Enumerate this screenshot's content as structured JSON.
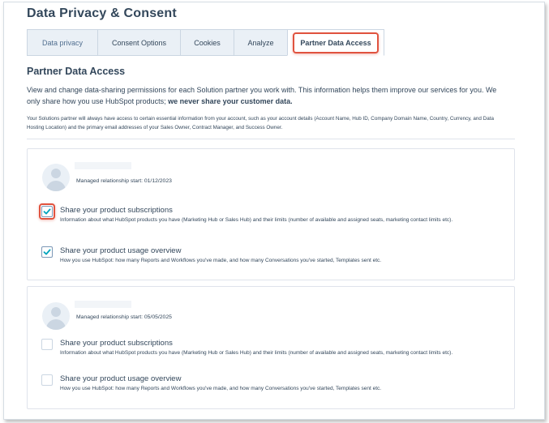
{
  "page_title": "Data Privacy & Consent",
  "tabs": [
    {
      "label": "Data privacy",
      "state": "muted"
    },
    {
      "label": "Consent Options",
      "state": "normal"
    },
    {
      "label": "Cookies",
      "state": "normal"
    },
    {
      "label": "Analyze",
      "state": "normal"
    },
    {
      "label": "Partner Data Access",
      "state": "active"
    }
  ],
  "section": {
    "title": "Partner Data Access",
    "intro_text": "View and change data-sharing permissions for each Solution partner you work with. This information helps them improve our services for you. We only share how you use HubSpot products; ",
    "intro_bold": "we never share your customer data.",
    "fine_print": "Your Solutions partner will always have access to certain essential information from your account, such as your account details (Account Name, Hub ID, Company Domain Name, Country, Currency, and Data Hosting Location) and the primary email addresses of your Sales Owner, Contract Manager, and Success Owner."
  },
  "partners": [
    {
      "managed_start": "Managed relationship start: 01/12/2023",
      "options": [
        {
          "title": "Share your product subscriptions",
          "desc": "Information about what HubSpot products you have (Marketing Hub or Sales Hub) and their limits (number of available and assigned seats, marketing contact limits etc).",
          "checked": true
        },
        {
          "title": "Share your product usage overview",
          "desc": "How you use HubSpot: how many Reports and Workflows you've made, and how many Conversations you've started, Templates sent etc.",
          "checked": true
        }
      ]
    },
    {
      "managed_start": "Managed relationship start: 05/05/2025",
      "options": [
        {
          "title": "Share your product subscriptions",
          "desc": "Information about what HubSpot products you have (Marketing Hub or Sales Hub) and their limits (number of available and assigned seats, marketing contact limits etc).",
          "checked": false
        },
        {
          "title": "Share your product usage overview",
          "desc": "How you use HubSpot: how many Reports and Workflows you've made, and how many Conversations you've started, Templates sent etc.",
          "checked": false
        }
      ]
    }
  ],
  "colors": {
    "text": "#33475b",
    "check": "#00a4bd",
    "highlight": "#e0533f",
    "tab_bg": "#eaf0f6"
  }
}
